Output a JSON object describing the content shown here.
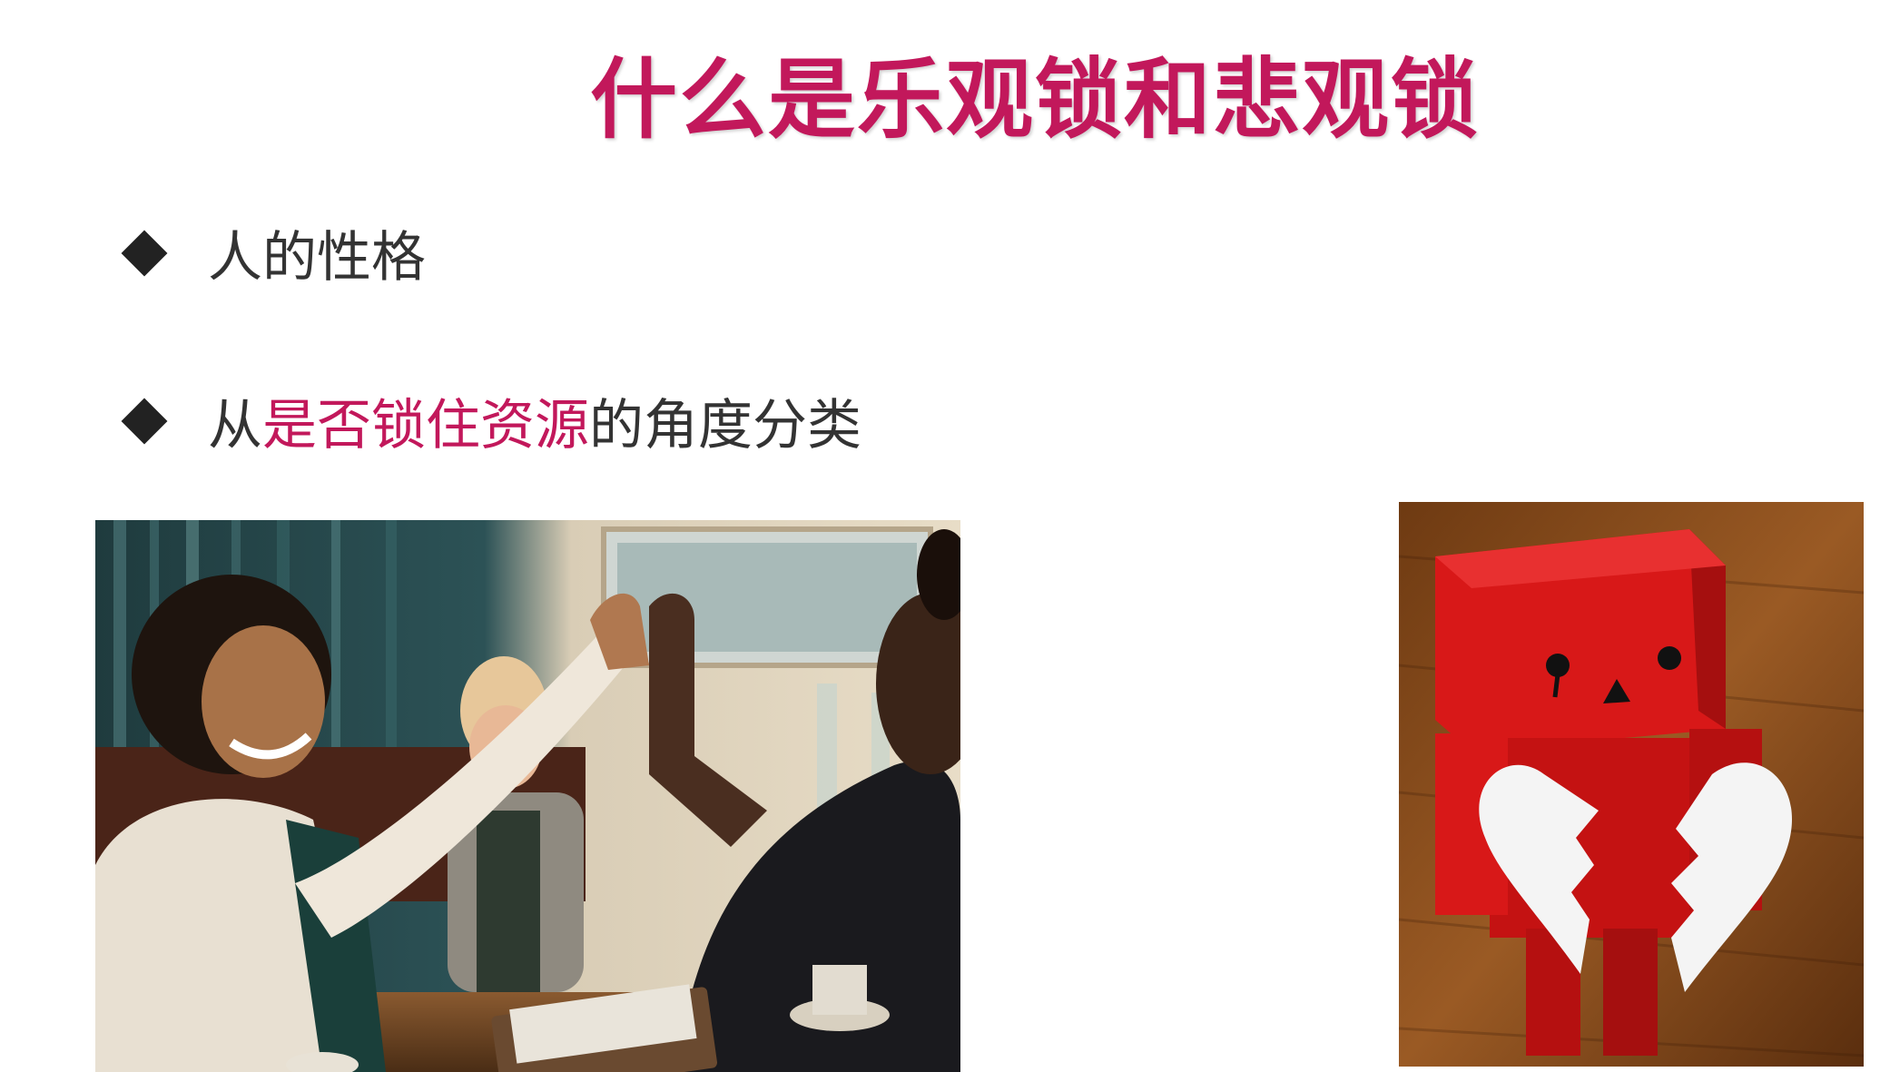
{
  "slide": {
    "title": "什么是乐观锁和悲观锁",
    "bullets": [
      {
        "text": "人的性格"
      },
      {
        "prefix": "从",
        "highlight": "是否锁住资源",
        "suffix": "的角度分类"
      }
    ],
    "accent_color": "#c2185b",
    "bullet_icon": "diamond-icon"
  },
  "images": {
    "left": {
      "subject": "high-five-photo"
    },
    "right": {
      "subject": "sad-red-robot-broken-heart-photo"
    }
  }
}
